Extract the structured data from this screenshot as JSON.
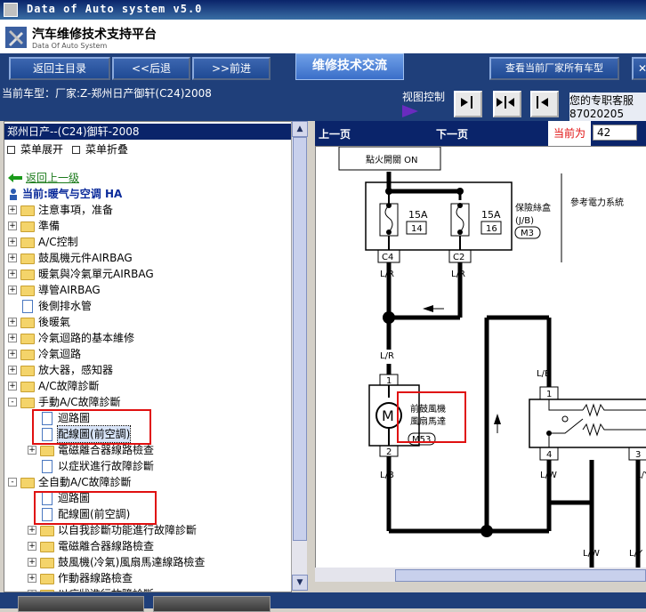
{
  "window": {
    "title": "Data of Auto system v5.0"
  },
  "header": {
    "title": "汽车维修技术支持平台",
    "subtitle": "Data Of Auto System"
  },
  "nav": {
    "home": "返回主目录",
    "back": "<<后退",
    "forward": ">>前进",
    "tab_label": "维修技术交流",
    "btn_current_all": "查看当前厂家所有车型"
  },
  "info": {
    "current_model": "当前车型：厂家:Z-郑州日产御轩(C24)2008",
    "view_control": "视图控制",
    "advisor_line1": "您的专职客服",
    "advisor_line2": "87020205"
  },
  "tree": {
    "header": "郑州日产--(C24)御轩-2008",
    "expand_all": "菜单展开",
    "collapse_all": "菜单折叠",
    "back_up": "返回上一级",
    "current": "当前:暖气与空调 HA",
    "items": [
      {
        "label": "注意事項，准备"
      },
      {
        "label": "準備"
      },
      {
        "label": "A/C控制"
      },
      {
        "label": "鼓風機元件AIRBAG"
      },
      {
        "label": "暖氣與冷氣單元AIRBAG"
      },
      {
        "label": "導管AIRBAG"
      },
      {
        "label": "後側排水管"
      },
      {
        "label": "後暖氣"
      },
      {
        "label": "冷氣迴路的基本維修"
      },
      {
        "label": "冷氣迴路"
      },
      {
        "label": "放大器，感知器"
      },
      {
        "label": "A/C故障診斷"
      },
      {
        "label": "手動A/C故障診斷"
      },
      {
        "label": "迴路圖"
      },
      {
        "label": "配線圖(前空調)"
      },
      {
        "label": "電磁離合器線路檢查"
      },
      {
        "label": "以症狀進行故障診斷"
      },
      {
        "label": "全自動A/C故障診斷"
      },
      {
        "label": "迴路圖"
      },
      {
        "label": "配線圖(前空調)"
      },
      {
        "label": "以自我診斷功能進行故障診斷"
      },
      {
        "label": "電磁離合器線路檢查"
      },
      {
        "label": "鼓風機(冷氣)風扇馬達線路檢查"
      },
      {
        "label": "作動器線路檢查"
      },
      {
        "label": "以症狀進行故障診斷"
      }
    ]
  },
  "viewer": {
    "prev": "上一页",
    "next": "下一页",
    "current_label": "当前为",
    "page_value": "42"
  },
  "diagram": {
    "ignition": "點火開關 ON",
    "fuse_box": "保險絲盒",
    "jb": "(J/B)",
    "m3": "M3",
    "ref_power": "參考電力系統",
    "fuse1_rating": "15A",
    "fuse1_no": "14",
    "fuse2_rating": "15A",
    "fuse2_no": "16",
    "c4": "C4",
    "c2": "C2",
    "lr": "L/R",
    "lb": "L/B",
    "lw": "L/W",
    "ly": "L/Y",
    "pin1": "1",
    "pin2": "2",
    "pin3": "3",
    "pin4": "4",
    "motor": "M",
    "blower_name_1": "前鼓風機",
    "blower_name_2": "風扇馬達",
    "m53": "M53"
  }
}
